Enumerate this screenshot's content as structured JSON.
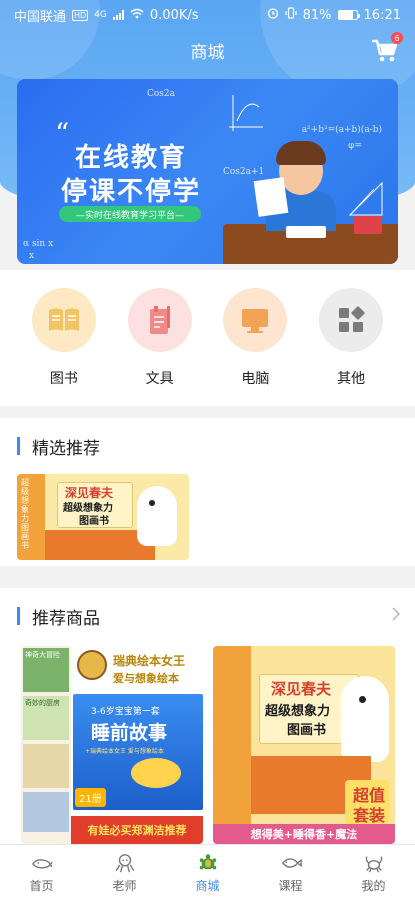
{
  "status_bar": {
    "carrier": "中国联通",
    "hd": "HD",
    "net": "4G",
    "speed": "0.00K/s",
    "battery": "81%",
    "time": "16:21"
  },
  "header": {
    "title": "商城",
    "cart_badge": "6"
  },
  "banner": {
    "quote": "“",
    "line1": "在线教育",
    "line2": "停课不停学",
    "pill": "—实时在线教育学习平台—",
    "formulas": [
      "Cos2a",
      "a²+b²=(a+b)(a-b)",
      "φ=",
      "Cos2a+1",
      "α sin x",
      "x"
    ]
  },
  "categories": [
    {
      "label": "图书",
      "icon": "book-icon",
      "bg": "#fde9c4",
      "fg": "#f2c463"
    },
    {
      "label": "文具",
      "icon": "stationery-icon",
      "bg": "#fde1e1",
      "fg": "#f08a8a"
    },
    {
      "label": "电脑",
      "icon": "computer-icon",
      "bg": "#fde5cf",
      "fg": "#f2a356"
    },
    {
      "label": "其他",
      "icon": "other-grid-icon",
      "bg": "#ececec",
      "fg": "#7b7b7b"
    }
  ],
  "featured": {
    "title": "精选推荐",
    "card": {
      "cover_line1": "深见春夫",
      "cover_line2": "超级想象力",
      "cover_line3": "图画书",
      "spine": "超级想象力图画书"
    }
  },
  "recommended": {
    "title": "推荐商品",
    "products": [
      {
        "top": "瑞典绘本女王",
        "top2": "爱与想象绘本",
        "box_top": "3-6岁宝宝第一套",
        "box_title": "睡前故事",
        "box_sub": "+瑞典绘本女王 爱与想象绘本",
        "count": "21册",
        "bottom": "有娃必买郑渊洁推荐",
        "thumbs": [
          "神奇大冒险",
          "奇妙的厨房",
          "",
          ""
        ]
      },
      {
        "cover_line1": "深见春夫",
        "cover_line2": "超级想象力",
        "cover_line3": "图画书",
        "bottom": "想得美+睡得香+魔法",
        "tag1": "超值",
        "tag2": "套装"
      }
    ]
  },
  "tabbar": {
    "items": [
      {
        "label": "首页",
        "icon": "whale-icon"
      },
      {
        "label": "老师",
        "icon": "octopus-icon"
      },
      {
        "label": "商城",
        "icon": "turtle-icon",
        "active": true
      },
      {
        "label": "课程",
        "icon": "fish-icon"
      },
      {
        "label": "我的",
        "icon": "crab-icon"
      }
    ]
  },
  "colors": {
    "accent": "#3d8af0",
    "header": "#5aa6f3"
  }
}
